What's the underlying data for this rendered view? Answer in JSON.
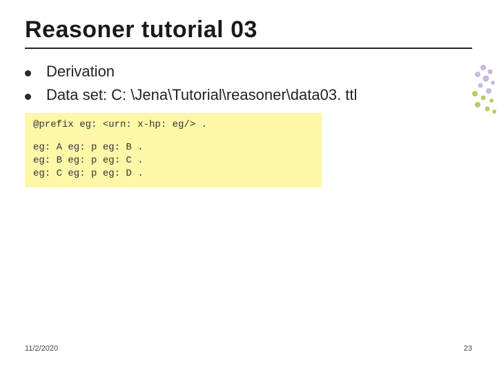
{
  "title": "Reasoner tutorial 03",
  "bullets": {
    "item0": "Derivation",
    "item1": "Data set: C: \\Jena\\Tutorial\\reasoner\\data03. ttl"
  },
  "code": {
    "l0": "@prefix eg: <urn: x-hp: eg/> .",
    "l1": "eg: A eg: p eg: B .",
    "l2": "eg: B eg: p eg: C .",
    "l3": "eg: C eg: p eg: D ."
  },
  "footer": {
    "date": "11/2/2020",
    "page": "23"
  }
}
